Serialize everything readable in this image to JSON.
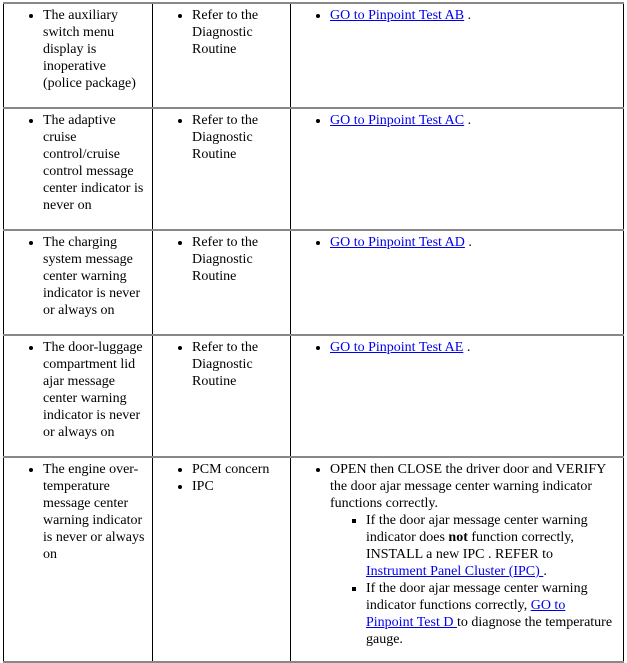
{
  "rows": [
    {
      "symptom": "The auxiliary switch menu display is inoperative (police package)",
      "source": [
        "Refer to the Diagnostic Routine"
      ],
      "action_link": "GO to Pinpoint Test AB",
      "action_suffix": " ."
    },
    {
      "symptom": "The adaptive cruise control/cruise control message center indicator is never on",
      "source": [
        "Refer to the Diagnostic Routine"
      ],
      "action_link": "GO to Pinpoint Test AC",
      "action_suffix": " ."
    },
    {
      "symptom": "The charging system message center warning indicator is never or always on",
      "source": [
        "Refer to the Diagnostic Routine"
      ],
      "action_link": "GO to Pinpoint Test AD",
      "action_suffix": " ."
    },
    {
      "symptom": "The door-luggage compartment lid ajar message center warning indicator is never or always on",
      "source": [
        "Refer to the Diagnostic Routine"
      ],
      "action_link": "GO to Pinpoint Test AE",
      "action_suffix": " ."
    },
    {
      "symptom": "The engine over-temperature message center warning indicator is never or always on",
      "source": [
        "PCM concern",
        "IPC"
      ],
      "action_main": "OPEN then CLOSE the driver door and VERIFY the door ajar message center warning indicator functions correctly.",
      "sub1_a": "If the door ajar message center warning indicator does ",
      "sub1_bold": "not",
      "sub1_b": " function correctly, INSTALL a new IPC . REFER to ",
      "sub1_link": "Instrument Panel Cluster (IPC) ",
      "sub1_end": ".",
      "sub2_a": "If the door ajar message center warning indicator functions correctly, ",
      "sub2_link": "GO to Pinpoint Test D ",
      "sub2_b": "to diagnose the temperature gauge."
    }
  ]
}
